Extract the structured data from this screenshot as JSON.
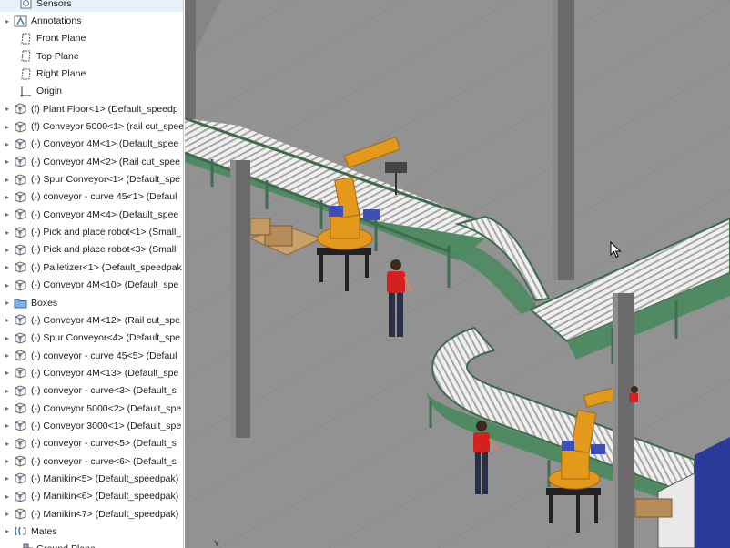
{
  "feature_tree": {
    "items": [
      {
        "label": "Sensors",
        "icon": "sensors-icon",
        "expander": "",
        "depth": 1
      },
      {
        "label": "Annotations",
        "icon": "annotations-icon",
        "expander": "▸",
        "depth": 0
      },
      {
        "label": "Front Plane",
        "icon": "plane-icon",
        "expander": "",
        "depth": 1
      },
      {
        "label": "Top Plane",
        "icon": "plane-icon",
        "expander": "",
        "depth": 1
      },
      {
        "label": "Right Plane",
        "icon": "plane-icon",
        "expander": "",
        "depth": 1
      },
      {
        "label": "Origin",
        "icon": "origin-icon",
        "expander": "",
        "depth": 1
      },
      {
        "label": "(f) Plant Floor<1> (Default_speedp",
        "icon": "part-icon",
        "expander": "▸",
        "depth": 0
      },
      {
        "label": "(f) Conveyor 5000<1> (rail cut_spee",
        "icon": "part-icon",
        "expander": "▸",
        "depth": 0
      },
      {
        "label": "(-) Conveyor 4M<1> (Default_spee",
        "icon": "part-icon",
        "expander": "▸",
        "depth": 0
      },
      {
        "label": "(-) Conveyor 4M<2> (Rail cut_spee",
        "icon": "part-icon",
        "expander": "▸",
        "depth": 0
      },
      {
        "label": "(-) Spur Conveyor<1> (Default_spe",
        "icon": "part-icon",
        "expander": "▸",
        "depth": 0
      },
      {
        "label": "(-) conveyor - curve 45<1> (Defaul",
        "icon": "part-icon",
        "expander": "▸",
        "depth": 0
      },
      {
        "label": "(-) Conveyor 4M<4> (Default_spee",
        "icon": "part-icon",
        "expander": "▸",
        "depth": 0
      },
      {
        "label": "(-) Pick and place robot<1> (Small_",
        "icon": "part-icon",
        "expander": "▸",
        "depth": 0
      },
      {
        "label": "(-) Pick and place robot<3> (Small",
        "icon": "part-icon",
        "expander": "▸",
        "depth": 0
      },
      {
        "label": "(-) Palletizer<1> (Default_speedpak",
        "icon": "part-icon",
        "expander": "▸",
        "depth": 0
      },
      {
        "label": "(-) Conveyor 4M<10> (Default_spe",
        "icon": "part-icon",
        "expander": "▸",
        "depth": 0
      },
      {
        "label": "Boxes",
        "icon": "folder-icon",
        "expander": "▸",
        "depth": 0
      },
      {
        "label": "(-) Conveyor 4M<12> (Rail cut_spe",
        "icon": "part-icon",
        "expander": "▸",
        "depth": 0
      },
      {
        "label": "(-) Spur Conveyor<4> (Default_spe",
        "icon": "part-icon",
        "expander": "▸",
        "depth": 0
      },
      {
        "label": "(-) conveyor - curve 45<5> (Defaul",
        "icon": "part-icon",
        "expander": "▸",
        "depth": 0
      },
      {
        "label": "(-) Conveyor 4M<13> (Default_spe",
        "icon": "part-icon",
        "expander": "▸",
        "depth": 0
      },
      {
        "label": "(-) conveyor - curve<3> (Default_s",
        "icon": "part-icon",
        "expander": "▸",
        "depth": 0
      },
      {
        "label": "(-) Conveyor 5000<2> (Default_spe",
        "icon": "part-icon",
        "expander": "▸",
        "depth": 0
      },
      {
        "label": "(-) Conveyor 3000<1> (Default_spe",
        "icon": "part-icon",
        "expander": "▸",
        "depth": 0
      },
      {
        "label": "(-) conveyor - curve<5> (Default_s",
        "icon": "part-icon",
        "expander": "▸",
        "depth": 0
      },
      {
        "label": "(-) conveyor - curve<6> (Default_s",
        "icon": "part-icon",
        "expander": "▸",
        "depth": 0
      },
      {
        "label": "(-) Manikin<5> (Default_speedpak)",
        "icon": "part-icon",
        "expander": "▸",
        "depth": 0
      },
      {
        "label": "(-) Manikin<6> (Default_speedpak)",
        "icon": "part-icon",
        "expander": "▸",
        "depth": 0
      },
      {
        "label": "(-) Manikin<7> (Default_speedpak)",
        "icon": "part-icon",
        "expander": "▸",
        "depth": 0
      },
      {
        "label": "Mates",
        "icon": "mates-icon",
        "expander": "▸",
        "depth": 0
      },
      {
        "label": "Ground Plane",
        "icon": "ground-plane-icon",
        "expander": "",
        "depth": 1
      }
    ]
  },
  "viewport": {
    "triad_label": "Y",
    "colors": {
      "floor": "#8f8f8f",
      "column": "#6d6d6d",
      "conveyor_frame": "#4f8a63",
      "roller": "#e8e8e8",
      "robot": "#e39a1c",
      "robot_dark": "#a36a10",
      "motor": "#3f4fb5",
      "shirt": "#d42020",
      "pants": "#2a2f45"
    }
  }
}
